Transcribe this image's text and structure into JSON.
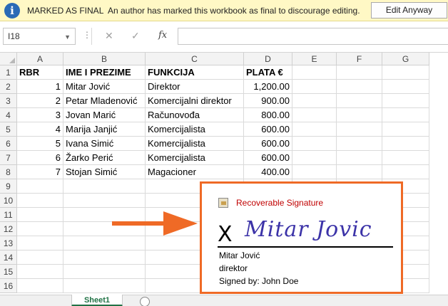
{
  "message_bar": {
    "icon": "info-icon",
    "title": "MARKED AS FINAL",
    "text": "An author has marked this workbook as final to discourage editing.",
    "button": "Edit Anyway",
    "colors": {
      "background": "#fff8c5",
      "icon": "#2a6ab6"
    }
  },
  "formula_bar": {
    "name_box": "I18",
    "fx_label": "fx",
    "formula": ""
  },
  "grid": {
    "columns": [
      "A",
      "B",
      "C",
      "D",
      "E",
      "F",
      "G"
    ],
    "rows": [
      "1",
      "2",
      "3",
      "4",
      "5",
      "6",
      "7",
      "8",
      "9",
      "10",
      "11",
      "12",
      "13",
      "14",
      "15",
      "16"
    ],
    "header_row": [
      "RBR",
      "IME I PREZIME",
      "FUNKCIJA",
      "PLATA €"
    ],
    "data": [
      [
        "1",
        "Mitar Jović",
        "Direktor",
        "1,200.00"
      ],
      [
        "2",
        "Petar Mladenović",
        "Komercijalni direktor",
        "900.00"
      ],
      [
        "3",
        "Jovan Marić",
        "Računovođa",
        "800.00"
      ],
      [
        "4",
        "Marija Janjić",
        "Komercijalista",
        "600.00"
      ],
      [
        "5",
        "Ivana Simić",
        "Komercijalista",
        "600.00"
      ],
      [
        "6",
        "Žarko Perić",
        "Komercijalista",
        "600.00"
      ],
      [
        "7",
        "Stojan Simić",
        "Magacioner",
        "400.00"
      ]
    ]
  },
  "signature": {
    "status": "Recoverable Signature",
    "mark": "X",
    "script_name": "Mitar Jovic",
    "signer": "Mitar Jović",
    "role": "direktor",
    "signed_by": "Signed by: John Doe",
    "colors": {
      "border": "#ef6a26",
      "status": "#c00000",
      "ink": "#3c33a8"
    }
  },
  "sheet_tabs": {
    "active": "Sheet1"
  },
  "colors": {
    "arrow": "#ef6a26",
    "accent": "#217346"
  }
}
